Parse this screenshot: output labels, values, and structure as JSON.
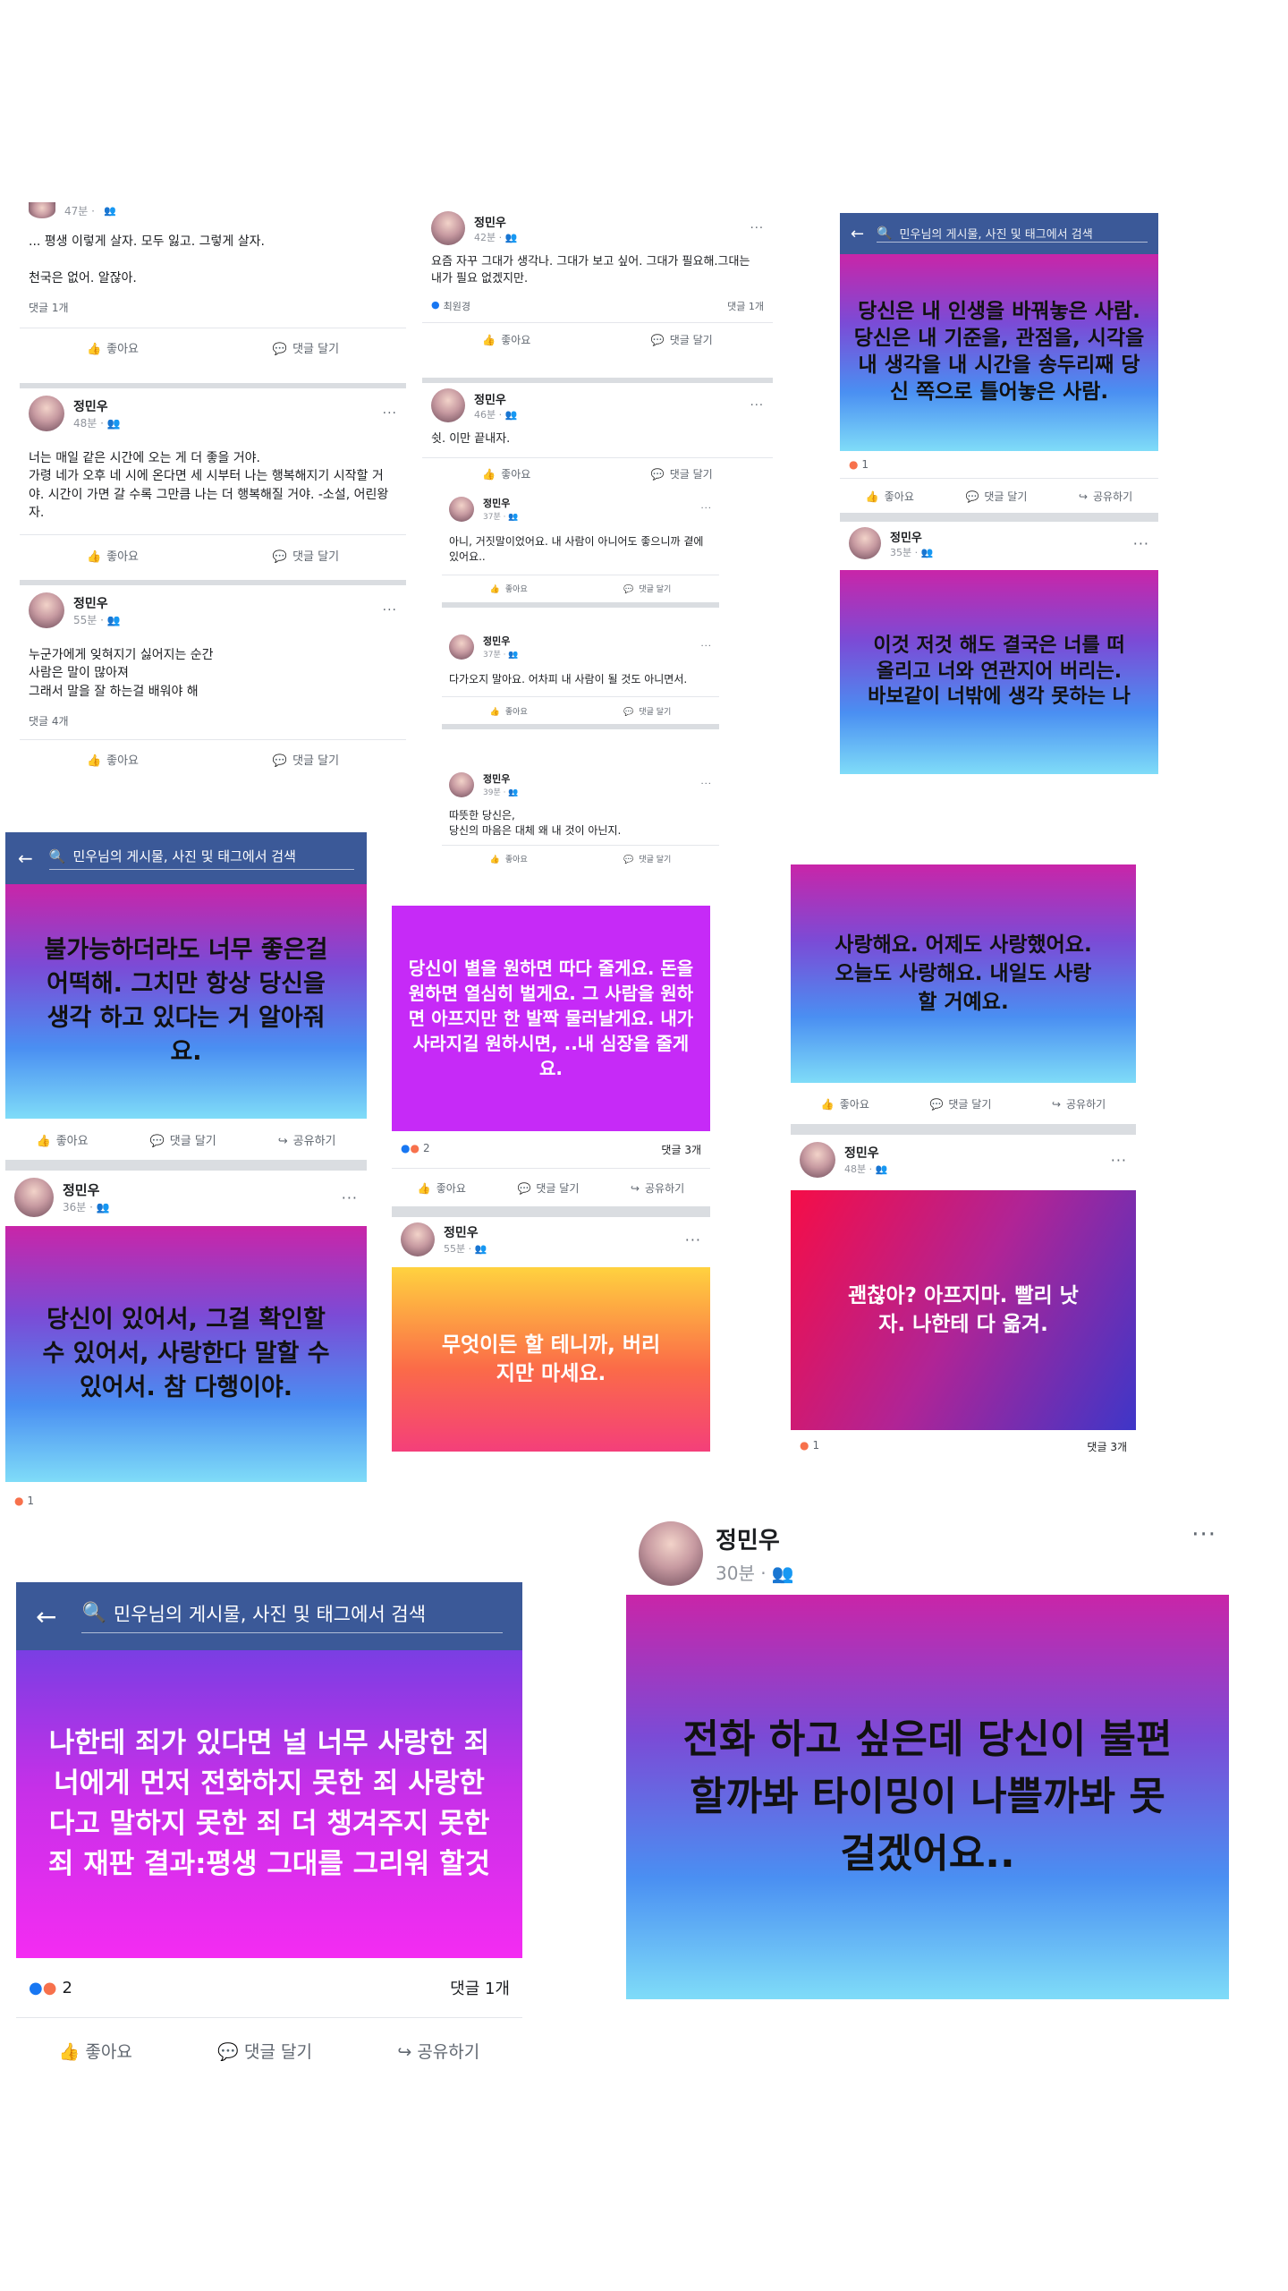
{
  "common": {
    "author": "정민우",
    "like": "좋아요",
    "comment": "댓글 달기",
    "share": "공유하기",
    "search_placeholder": "민우님의 게시물, 사진 및 태그에서 검색",
    "dots": "···"
  },
  "c1": {
    "p1": {
      "time": "47분 · ",
      "text": "... 평생 이렇게 살자. 모두 잃고. 그렇게 살자.\n\n천국은 없어. 알잖아.",
      "comments": "댓글 1개"
    },
    "p2": {
      "time": "48분 · ",
      "text": "너는 매일 같은 시간에 오는 게 더 좋을 거야.\n가령 네가 오후 네 시에 온다면 세 시부터 나는 행복해지기 시작할 거야. 시간이 가면 갈 수록 그만큼 나는 더 행복해질 거야. -소설, 어린왕자."
    },
    "p3": {
      "time": "55분 · ",
      "text": "누군가에게 잊혀지기 싫어지는 순간\n 사람은 말이 많아져\n그래서 말을 잘 하는걸 배워야 해",
      "comments": "댓글 4개"
    }
  },
  "c2": {
    "p1": {
      "time": "42분 · ",
      "text": "요즘 자꾸 그대가 생각나. 그대가 보고 싶어. 그대가 필요해.그대는 내가 필요 없겠지만.",
      "reactor": "최원경",
      "comments": "댓글 1개"
    },
    "p2": {
      "time": "46분 · ",
      "text": "쉿. 이만 끝내자."
    },
    "p3": {
      "time": "37분 · ",
      "text": "아니, 거짓말이었어요. 내 사람이 아니어도 좋으니까 곁에 있어요.."
    },
    "p4": {
      "time": "37분 · ",
      "text": "다가오지 말아요. 어차피 내 사람이 될 것도 아니면서."
    },
    "p5": {
      "time": "39분 · ",
      "text": "따뜻한 당신은,\n당신의 마음은 대체 왜 내 것이 아닌지."
    }
  },
  "c3": {
    "image_text": "당신은 내 인생을 바꿔놓은 사람. 당신은 내 기준을, 관점을, 시각을 내 생각을 내 시간을 송두리째 당신 쪽으로 틀어놓은 사람.",
    "reactions": "1",
    "p2": {
      "time": "35분 · ",
      "image_text": "이것 저것 해도 결국은 너를 떠올리고 너와 연관지어 버리는. 바보같이 너밖에 생각 못하는 나"
    }
  },
  "c4": {
    "image_text": "불가능하더라도 너무 좋은걸 어떡해. 그치만 항상 당신을 생각 하고 있다는 거 알아줘요.",
    "p2": {
      "time": "36분 · ",
      "image_text": "당신이 있어서, 그걸 확인할 수 있어서, 사랑한다 말할 수 있어서. 참 다행이야."
    },
    "reactions": "1"
  },
  "c5": {
    "image_text": "당신이 별을 원하면 따다 줄게요. 돈을 원하면 열심히 벌게요. 그 사람을 원하면 아프지만 한 발짝 물러날게요. 내가 사라지길 원하시면, ..내 심장을 줄게요.",
    "reactions": "2",
    "comments": "댓글 3개",
    "p2": {
      "time": "55분 · ",
      "image_text": "무엇이든 할 테니까, 버리지만 마세요."
    }
  },
  "c6": {
    "image_text": "사랑해요. 어제도 사랑했어요. 오늘도 사랑해요. 내일도 사랑할 거예요.",
    "p2": {
      "time": "48분 · ",
      "image_text": "괜찮아? 아프지마. 빨리 낫자. 나한테 다 옮겨."
    },
    "reactions": "1",
    "comments": "댓글 3개"
  },
  "c7": {
    "image_text": "나한테 죄가 있다면 널 너무 사랑한 죄 너에게 먼저 전화하지 못한 죄 사랑한다고 말하지 못한 죄  더 챙겨주지 못한 죄  재판 결과:평생 그대를 그리워 할것",
    "reactions": "2",
    "comments": "댓글 1개"
  },
  "c8": {
    "time": "30분 · ",
    "image_text": "전화 하고 싶은데 당신이 불편할까봐 타이밍이 나쁠까봐 못걸겠어요.."
  }
}
